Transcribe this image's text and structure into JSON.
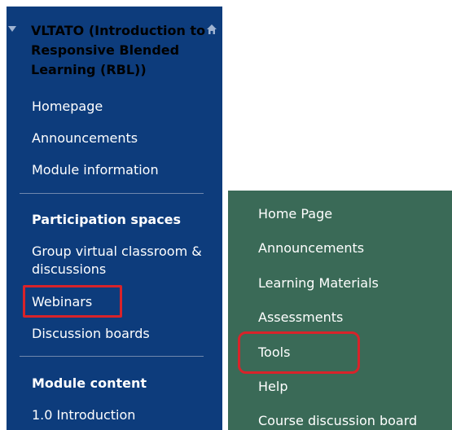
{
  "left_menu": {
    "course_title": "VLTATO (Introduction to Responsive Blended Learning (RBL))",
    "items": [
      "Homepage",
      "Announcements",
      "Module information"
    ],
    "participation": {
      "heading": "Participation spaces",
      "items": [
        "Group virtual classroom & discussions",
        "Webinars",
        "Discussion boards"
      ]
    },
    "module_content": {
      "heading": "Module content",
      "items": [
        "1.0 Introduction"
      ]
    }
  },
  "right_menu": {
    "items": [
      "Home Page",
      "Announcements",
      "Learning Materials",
      "Assessments",
      "Tools",
      "Help",
      "Course discussion board"
    ]
  },
  "colors": {
    "left_bg": "#0d3c7c",
    "right_bg": "#3a6a57",
    "highlight": "#d8232a"
  }
}
